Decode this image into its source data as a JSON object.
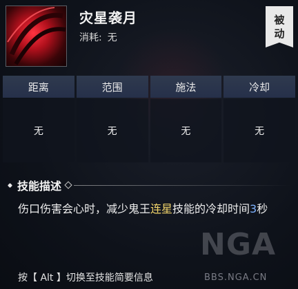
{
  "skill": {
    "name": "灾星袭月",
    "cost_label": "消耗:",
    "cost_value": "无",
    "type_badge_1": "被",
    "type_badge_2": "动"
  },
  "stats": {
    "headers": [
      "距离",
      "范围",
      "施法",
      "冷却"
    ],
    "values": [
      "无",
      "无",
      "无",
      "无"
    ]
  },
  "description": {
    "heading": "技能描述",
    "parts": {
      "p1": "伤口伤害会心时，减少鬼王",
      "p2": "连星",
      "p3": "技能的冷却时间",
      "p4": "3",
      "p5": "秒"
    }
  },
  "footer": {
    "hint": "按【 Alt 】切换至技能简要信息"
  },
  "watermark": {
    "logo_text": "NGA",
    "url": "BBS.NGA.CN"
  },
  "colors": {
    "highlight_yellow": "#f0d36a",
    "highlight_blue": "#7fb3ff",
    "icon_red": "#c8101c"
  }
}
